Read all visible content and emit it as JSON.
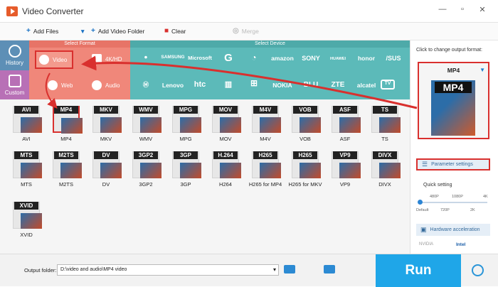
{
  "window": {
    "title": "Video Converter"
  },
  "toolbar": {
    "add_files": "Add Files",
    "add_folder": "Add Video Folder",
    "clear": "Clear",
    "merge": "Merge"
  },
  "side": {
    "history": "History",
    "custom": "Custom"
  },
  "categories": {
    "select_format": "Select Format",
    "select_device": "Select Device",
    "video": "Video",
    "k4": "4K/HD",
    "web": "Web",
    "audio": "Audio"
  },
  "devices": {
    "row1": [
      "",
      "SAMSUNG",
      "Microsoft",
      "G",
      "",
      "amazon",
      "SONY",
      "HUAWEI",
      "honor",
      "/SUS"
    ],
    "row2": [
      "",
      "Lenovo",
      "htc",
      "",
      "",
      "NOKIA",
      "BLU",
      "ZTE",
      "alcatel",
      "TV"
    ]
  },
  "formats": [
    {
      "label": "AVI",
      "cap": "AVI"
    },
    {
      "label": "MP4",
      "cap": "MP4"
    },
    {
      "label": "MKV",
      "cap": "MKV"
    },
    {
      "label": "WMV",
      "cap": "WMV"
    },
    {
      "label": "MPG",
      "cap": "MPG"
    },
    {
      "label": "MOV",
      "cap": "MOV"
    },
    {
      "label": "M4V",
      "cap": "M4V"
    },
    {
      "label": "VOB",
      "cap": "VOB"
    },
    {
      "label": "ASF",
      "cap": "ASF"
    },
    {
      "label": "TS",
      "cap": "TS"
    },
    {
      "label": "MTS",
      "cap": "MTS"
    },
    {
      "label": "M2TS",
      "cap": "M2TS"
    },
    {
      "label": "DV",
      "cap": "DV"
    },
    {
      "label": "3GP2",
      "cap": "3GP2"
    },
    {
      "label": "3GP",
      "cap": "3GP"
    },
    {
      "label": "H.264",
      "cap": "H264"
    },
    {
      "label": "H265",
      "cap": "H265 for MP4"
    },
    {
      "label": "H265",
      "cap": "H265 for MKV"
    },
    {
      "label": "VP9",
      "cap": "VP9"
    },
    {
      "label": "DIVX",
      "cap": "DIVX"
    },
    {
      "label": "XVID",
      "cap": "XVID"
    }
  ],
  "output": {
    "hint": "Click to change output format:",
    "format": "MP4",
    "icon_label": "MP4"
  },
  "right": {
    "param": "Parameter settings",
    "quick": "Quick setting",
    "ticks_top": [
      "480P",
      "1080P",
      "4K"
    ],
    "ticks_bottom": [
      "Default",
      "720P",
      "2K"
    ],
    "hw": "Hardware acceleration",
    "nvidia": "NVIDIA",
    "intel": "Intel"
  },
  "bottom": {
    "label": "Output folder:",
    "path": "D:\\video and audio\\MP4 video",
    "run": "Run"
  },
  "colors": {
    "accent": "#1fa6e8",
    "highlight": "#d9302e",
    "format_panel": "#f0877a",
    "device_panel": "#5cbab9"
  }
}
